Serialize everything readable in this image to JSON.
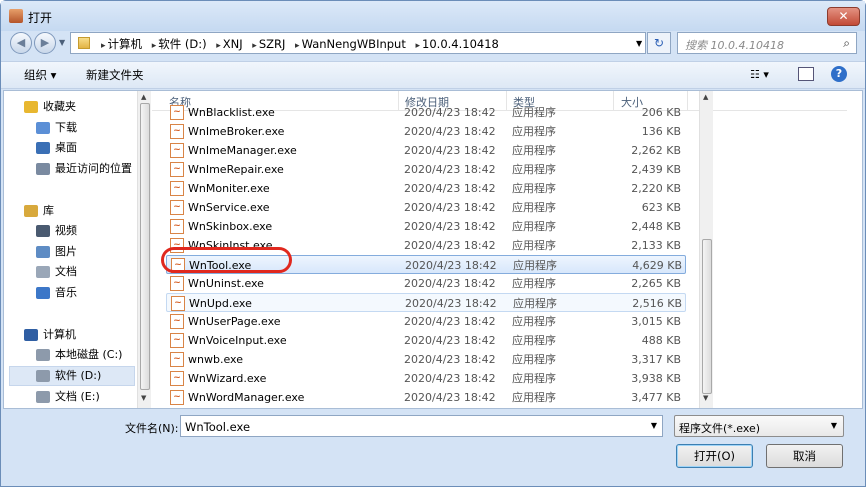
{
  "window": {
    "title": "打开",
    "close_label": "✕"
  },
  "address": {
    "crumbs": [
      "计算机",
      "软件 (D:)",
      "XNJ",
      "SZRJ",
      "WanNengWBInput",
      "10.0.4.10418"
    ],
    "search_placeholder": "搜索 10.0.4.10418"
  },
  "toolbar": {
    "organize": "组织 ▾",
    "new_folder": "新建文件夹"
  },
  "nav": {
    "items": [
      {
        "label": "收藏夹",
        "icon": "star-icon",
        "color": "#e8b730"
      },
      {
        "label": "下载",
        "icon": "download-folder-icon",
        "color": "#5b8fd6"
      },
      {
        "label": "桌面",
        "icon": "desktop-icon",
        "color": "#3a6fb5"
      },
      {
        "label": "最近访问的位置",
        "icon": "recent-places-icon",
        "color": "#7a8aa0"
      },
      {
        "label": "库",
        "icon": "library-icon",
        "color": "#d8a93c"
      },
      {
        "label": "视频",
        "icon": "video-icon",
        "color": "#4a5a70"
      },
      {
        "label": "图片",
        "icon": "pictures-icon",
        "color": "#5e8cc4"
      },
      {
        "label": "文档",
        "icon": "documents-icon",
        "color": "#9aa7b8"
      },
      {
        "label": "音乐",
        "icon": "music-icon",
        "color": "#3c77c8"
      },
      {
        "label": "计算机",
        "icon": "computer-icon",
        "color": "#2f5ea3"
      },
      {
        "label": "本地磁盘 (C:)",
        "icon": "drive-c-icon",
        "color": "#8d9aab"
      },
      {
        "label": "软件 (D:)",
        "icon": "drive-d-icon",
        "color": "#8d9aab"
      },
      {
        "label": "文档 (E:)",
        "icon": "drive-e-icon",
        "color": "#8d9aab"
      }
    ]
  },
  "columns": {
    "name": "名称",
    "date": "修改日期",
    "type": "类型",
    "size": "大小"
  },
  "files": [
    {
      "name": "WnBlacklist.exe",
      "date": "2020/4/23 18:42",
      "type": "应用程序",
      "size": "206 KB"
    },
    {
      "name": "WnImeBroker.exe",
      "date": "2020/4/23 18:42",
      "type": "应用程序",
      "size": "136 KB"
    },
    {
      "name": "WnImeManager.exe",
      "date": "2020/4/23 18:42",
      "type": "应用程序",
      "size": "2,262 KB"
    },
    {
      "name": "WnImeRepair.exe",
      "date": "2020/4/23 18:42",
      "type": "应用程序",
      "size": "2,439 KB"
    },
    {
      "name": "WnMoniter.exe",
      "date": "2020/4/23 18:42",
      "type": "应用程序",
      "size": "2,220 KB"
    },
    {
      "name": "WnService.exe",
      "date": "2020/4/23 18:42",
      "type": "应用程序",
      "size": "623 KB"
    },
    {
      "name": "WnSkinbox.exe",
      "date": "2020/4/23 18:42",
      "type": "应用程序",
      "size": "2,448 KB"
    },
    {
      "name": "WnSkinInst.exe",
      "date": "2020/4/23 18:42",
      "type": "应用程序",
      "size": "2,133 KB"
    },
    {
      "name": "WnTool.exe",
      "date": "2020/4/23 18:42",
      "type": "应用程序",
      "size": "4,629 KB"
    },
    {
      "name": "WnUninst.exe",
      "date": "2020/4/23 18:42",
      "type": "应用程序",
      "size": "2,265 KB"
    },
    {
      "name": "WnUpd.exe",
      "date": "2020/4/23 18:42",
      "type": "应用程序",
      "size": "2,516 KB"
    },
    {
      "name": "WnUserPage.exe",
      "date": "2020/4/23 18:42",
      "type": "应用程序",
      "size": "3,015 KB"
    },
    {
      "name": "WnVoiceInput.exe",
      "date": "2020/4/23 18:42",
      "type": "应用程序",
      "size": "488 KB"
    },
    {
      "name": "wnwb.exe",
      "date": "2020/4/23 18:42",
      "type": "应用程序",
      "size": "3,317 KB"
    },
    {
      "name": "WnWizard.exe",
      "date": "2020/4/23 18:42",
      "type": "应用程序",
      "size": "3,938 KB"
    },
    {
      "name": "WnWordManager.exe",
      "date": "2020/4/23 18:42",
      "type": "应用程序",
      "size": "3,477 KB"
    }
  ],
  "bottom": {
    "filename_label": "文件名(N):",
    "filename_value": "WnTool.exe",
    "filter": "程序文件(*.exe)",
    "open": "打开(O)",
    "cancel": "取消"
  }
}
